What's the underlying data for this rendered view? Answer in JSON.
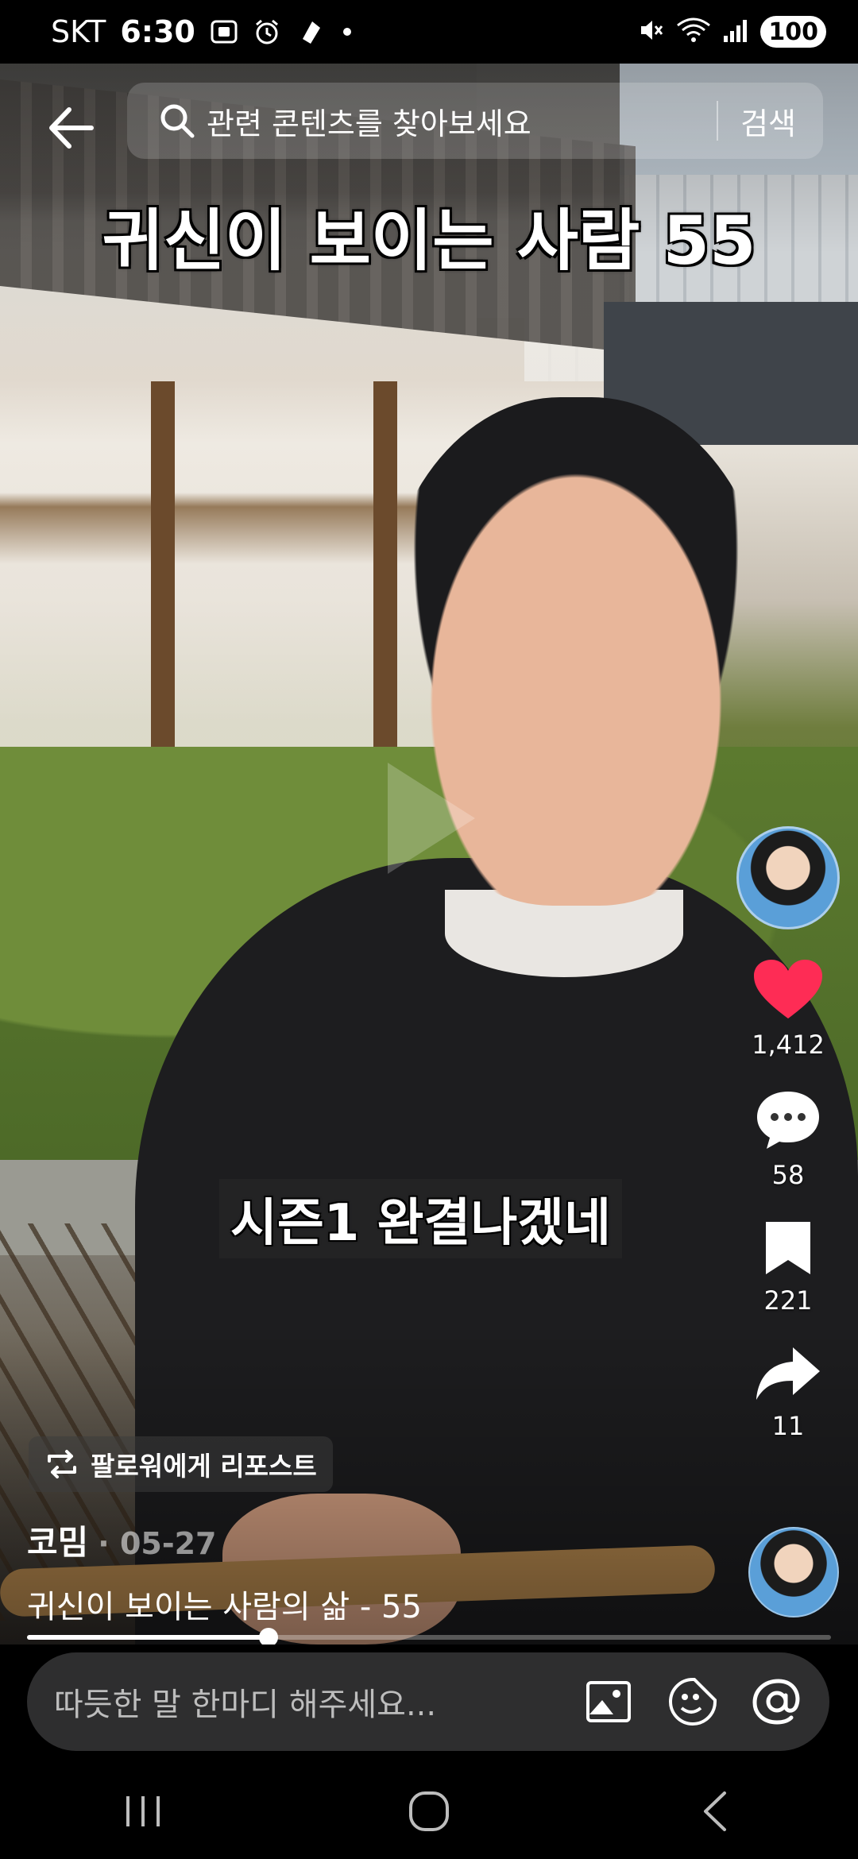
{
  "status_bar": {
    "carrier": "SKT",
    "time": "6:30",
    "battery": "100",
    "icons": [
      "screenshot-icon",
      "alarm-icon",
      "notification-icon",
      "mute-icon",
      "wifi-icon",
      "signal-icon"
    ]
  },
  "search": {
    "placeholder": "관련 콘텐츠를 찾아보세요",
    "submit_label": "검색"
  },
  "video": {
    "title_overlay": "귀신이 보이는 사람 55",
    "subtitle": "시즌1 완결나겠네",
    "progress_fraction": 0.3
  },
  "actions": {
    "likes": "1,412",
    "comments": "58",
    "saves": "221",
    "shares": "11",
    "like_color": "#fe2c55"
  },
  "post": {
    "repost_label": "팔로워에게 리포스트",
    "author": "코밈",
    "date": "· 05-27",
    "caption": "귀신이 보이는 사람의 삶 - 55"
  },
  "comment_bar": {
    "placeholder": "따듯한 말 한마디 해주세요..."
  },
  "nav": [
    "recent-apps-icon",
    "home-icon",
    "back-icon"
  ]
}
